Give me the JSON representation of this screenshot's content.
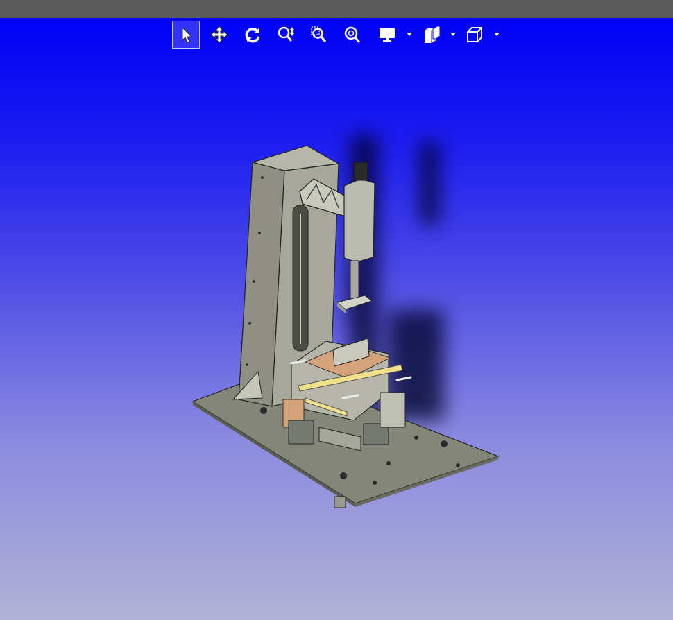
{
  "toolbar": {
    "tools": [
      {
        "id": "select",
        "icon": "pointer-arrow-icon",
        "active": true
      },
      {
        "id": "pan",
        "icon": "pan-arrows-icon",
        "active": false
      },
      {
        "id": "rotate",
        "icon": "rotate-icon",
        "active": false
      },
      {
        "id": "zoom",
        "icon": "zoom-updown-icon",
        "active": false
      },
      {
        "id": "zoom-area",
        "icon": "zoom-area-icon",
        "active": false
      },
      {
        "id": "zoom-fit",
        "icon": "zoom-fit-icon",
        "active": false
      },
      {
        "id": "display-mode",
        "icon": "monitor-icon",
        "dropdown": true
      },
      {
        "id": "view-style",
        "icon": "shaded-cubes-icon",
        "dropdown": true
      },
      {
        "id": "standard-view",
        "icon": "iso-cube-icon",
        "dropdown": true
      }
    ]
  },
  "colors": {
    "accent": "#0000f6",
    "titlebar": "#5a5a5a",
    "model_metal": "#8a8b7e",
    "model_highlight": "#f0e08a",
    "model_copper": "#d4a37a"
  }
}
